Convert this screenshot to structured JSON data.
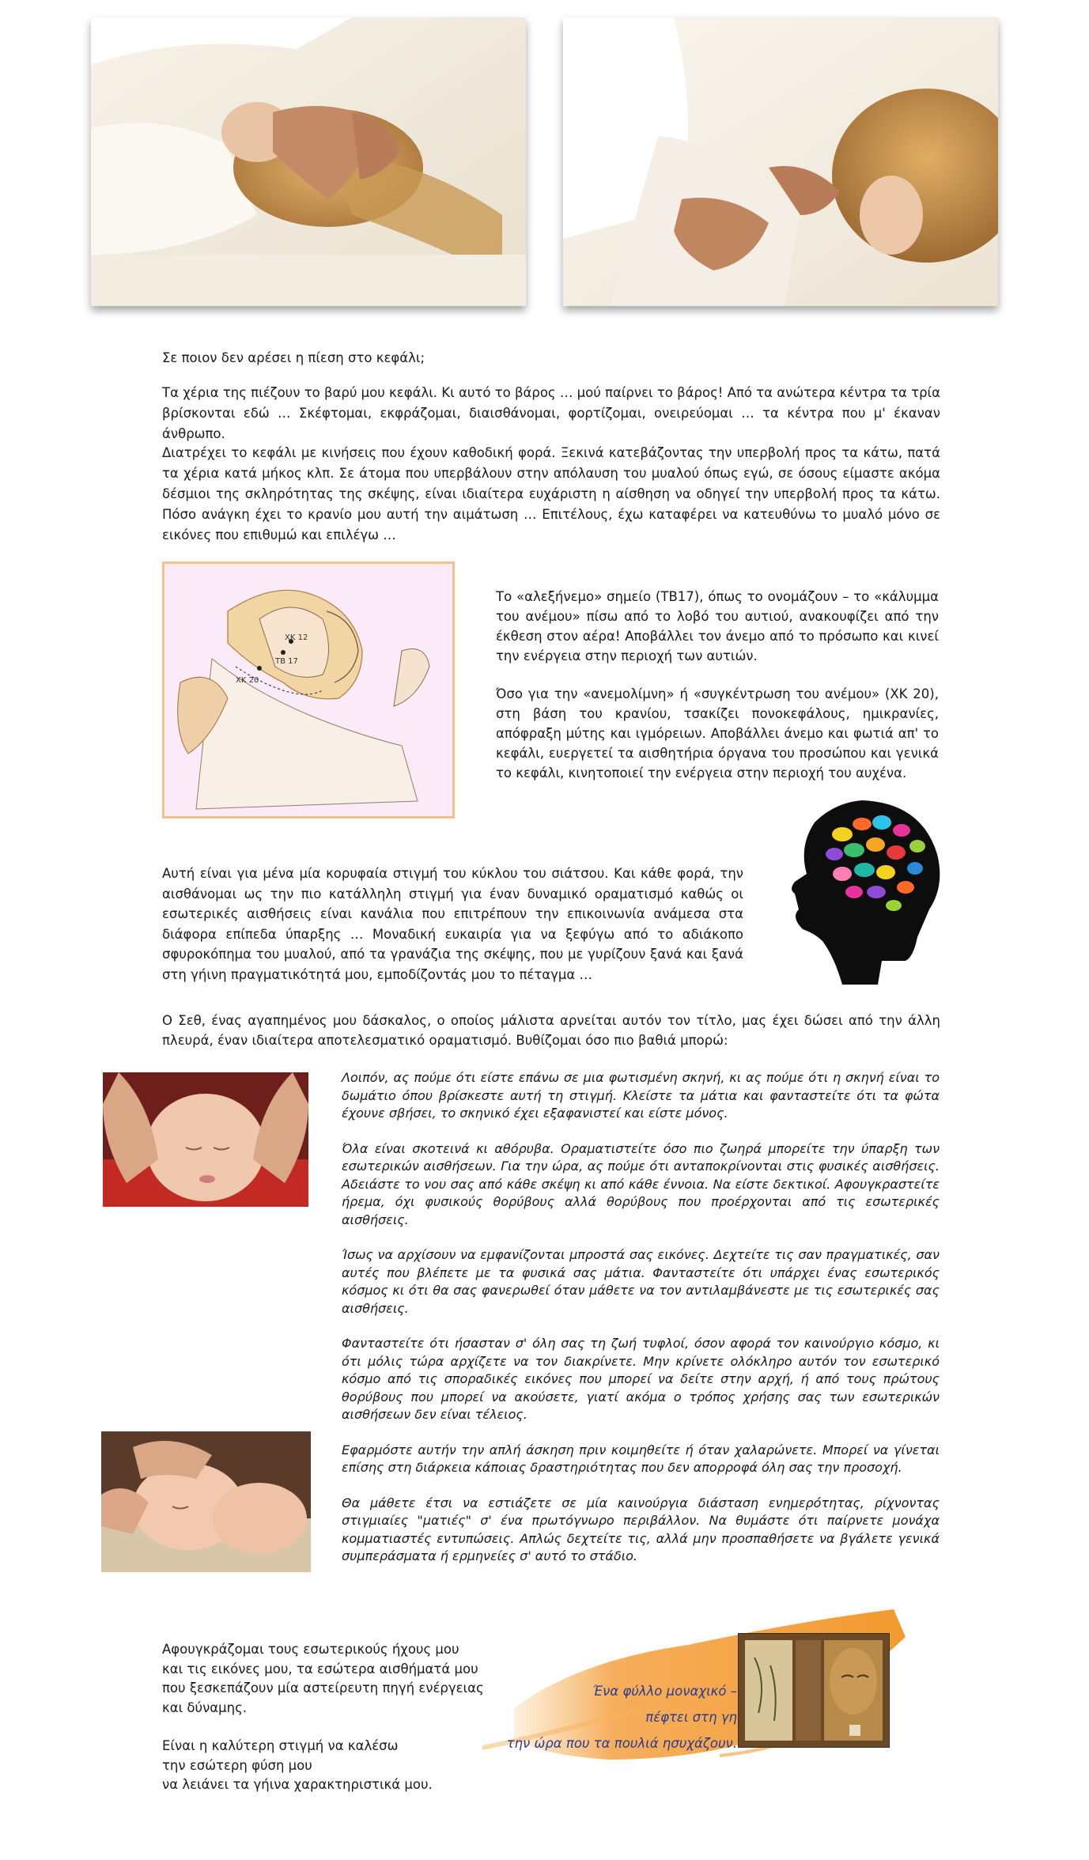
{
  "intro": {
    "question": "Σε ποιον δεν αρέσει η πίεση στο κεφάλι;",
    "p1": "Τα χέρια της πιέζουν το βαρύ μου κεφάλι. Κι αυτό το βάρος … μού παίρνει το βάρος! Από τα ανώτερα κέντρα τα τρία βρίσκονται εδώ … Σκέφτομαι, εκφράζομαι, διαισθάνομαι, φορτίζομαι, ονειρεύομαι … τα κέντρα που μ' έκαναν άνθρωπο.",
    "p2": "Διατρέχει το κεφάλι με κινήσεις που έχουν καθοδική φορά. Ξεκινά κατεβάζοντας την υπερβολή προς τα κάτω, πατά τα χέρια κατά μήκος κλπ. Σε άτομα που υπερβάλουν στην απόλαυση του μυαλού όπως εγώ, σε όσους είμαστε ακόμα δέσμιοι της σκληρότητας της σκέψης, είναι ιδιαίτερα ευχάριστη η αίσθηση να οδηγεί την υπερβολή προς τα κάτω. Πόσο ανάγκη έχει το κρανίο μου αυτή την αιμάτωση … Επιτέλους, έχω καταφέρει να κατευθύνω το μυαλό μόνο σε εικόνες που επιθυμώ και επιλέγω …"
  },
  "diagram": {
    "labels": [
      "XK 12",
      "TB 17",
      "XK 20"
    ]
  },
  "points": {
    "p1": "Το «αλεξήνεμο» σημείο (TB17), όπως το ονομάζουν – το «κάλυμμα του ανέμου» πίσω από το λοβό του αυτιού, ανακουφίζει από την έκθεση στον αέρα! Αποβάλλει τον άνεμο από το πρόσωπο και κινεί την ενέργεια στην περιοχή των αυτιών.",
    "p2": "Όσο για την «ανεμολίμνη» ή «συγκέντρωση του ανέμου» (ΧΚ 20), στη βάση του κρανίου, τσακίζει πονοκεφάλους, ημικρανίες, απόφραξη μύτης και ιγμόρειων. Αποβάλλει άνεμο και φωτιά απ' το κεφάλι, ευεργετεί τα αισθητήρια όργανα του προσώπου και γενικά το κεφάλι, κινητοποιεί την ενέργεια στην περιοχή του αυχένα."
  },
  "peak": {
    "text": "Αυτή είναι για μένα μία κορυφαία στιγμή του κύκλου του σιάτσου. Και κάθε φορά, την αισθάνομαι ως την πιο κατάλληλη στιγμή για έναν δυναμικό οραματισμό καθώς οι εσωτερικές αισθήσεις είναι κανάλια που επιτρέπουν την επικοινωνία ανάμεσα στα διάφορα επίπεδα ύπαρξης … Μοναδική ευκαιρία για να ξεφύγω από το αδιάκοπο σφυροκόπημα του μυαλού, από τα γρανάζια της σκέψης, που με γυρίζουν ξανά και ξανά στη γήινη πραγματικότητά μου, εμποδίζοντάς μου το πέταγμα …"
  },
  "seth": {
    "text": "Ο Σεθ, ένας αγαπημένος μου δάσκαλος, ο οποίος μάλιστα αρνείται αυτόν τον τίτλο, μας έχει δώσει από την άλλη πλευρά, έναν ιδιαίτερα αποτελεσματικό οραματισμό. Βυθίζομαι όσο πιο βαθιά μπορώ:"
  },
  "visualization": {
    "p1": "Λοιπόν, ας πούμε ότι είστε επάνω σε μια φωτισμένη σκηνή, κι ας πούμε ότι η σκηνή είναι το δωμάτιο όπου βρίσκεστε αυτή τη στιγμή. Κλείστε τα μάτια και φανταστείτε ότι τα φώτα έχουνε σβήσει, το σκηνικό έχει εξαφανιστεί και είστε μόνος.",
    "p2": "Όλα είναι σκοτεινά κι αθόρυβα. Οραματιστείτε όσο πιο ζωηρά μπορείτε την ύπαρξη των εσωτερικών αισθήσεων. Για την ώρα, ας πούμε ότι ανταποκρίνονται στις φυσικές αισθήσεις. Αδειάστε το νου σας από κάθε σκέψη κι από κάθε έννοια. Να είστε δεκτικοί. Αφουγκραστείτε ήρεμα, όχι φυσικούς θορύβους αλλά θορύβους που προέρχονται από τις εσωτερικές αισθήσεις.",
    "p3": "Ίσως να αρχίσουν να εμφανίζονται μπροστά σας εικόνες. Δεχτείτε τις σαν πραγματικές, σαν αυτές που βλέπετε με τα φυσικά σας μάτια. Φανταστείτε ότι υπάρχει ένας εσωτερικός κόσμος κι ότι θα σας φανερωθεί όταν μάθετε να τον αντιλαμβάνεστε με τις εσωτερικές σας αισθήσεις.",
    "p4": "Φανταστείτε ότι ήσασταν σ' όλη σας τη ζωή τυφλοί, όσον αφορά τον καινούργιο κόσμο, κι ότι μόλις τώρα αρχίζετε να τον διακρίνετε. Μην κρίνετε ολόκληρο αυτόν τον εσωτερικό κόσμο από τις σποραδικές εικόνες που μπορεί να δείτε στην αρχή, ή από τους πρώτους θορύβους που μπορεί να ακούσετε, γιατί ακόμα ο τρόπος χρήσης σας των εσωτερικών αισθήσεων δεν είναι τέλειος.",
    "p5": "Εφαρμόστε αυτήν την απλή άσκηση πριν κοιμηθείτε ή όταν χαλαρώνετε. Μπορεί να γίνεται επίσης στη διάρκεια κάποιας δραστηριότητας που δεν απορροφά όλη σας την προσοχή.",
    "p6": "Θα μάθετε έτσι να εστιάζετε σε μία καινούργια διάσταση ενημερότητας, ρίχνοντας στιγμιαίες \"ματιές\" σ' ένα πρωτόγνωρο περιβάλλον. Να θυμάστε ότι παίρνετε μονάχα κομματιαστές εντυπώσεις. Απλώς δεχτείτε τις, αλλά μην προσπαθήσετε να βγάλετε γενικά συμπεράσματα ή ερμηνείες σ' αυτό το στάδιο."
  },
  "closing": {
    "l1": "Αφουγκράζομαι τους εσωτερικούς ήχους μου",
    "l2": "και τις εικόνες μου, τα εσώτερα αισθήματά μου",
    "l3": "που ξεσκεπάζουν μία αστείρευτη πηγή ενέργειας",
    "l4": "και δύναμης.",
    "l5": "Είναι η καλύτερη στιγμή να καλέσω",
    "l6": "την εσώτερη φύση μου",
    "l7": "να λειάνει τα γήινα χαρακτηριστικά μου."
  },
  "haiku": {
    "l1": "Ένα φύλλο μοναχικό –",
    "l2": "πέφτει στη γη",
    "l3": "την ώρα που τα πουλιά ησυχάζουν."
  },
  "colors": {
    "accent_orange": "#f29a2e",
    "haiku_text": "#2a3b8f",
    "diagram_bg": "#fbeaf7"
  }
}
